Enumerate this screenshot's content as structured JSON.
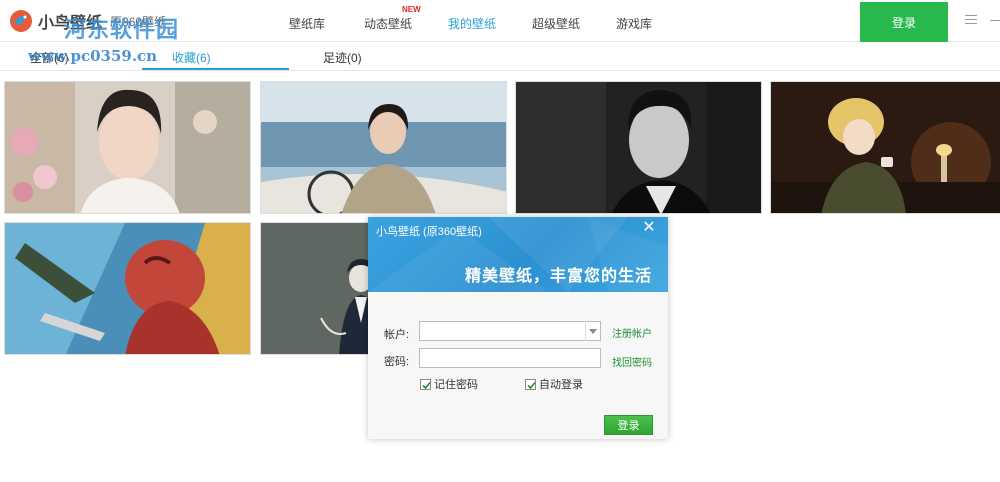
{
  "app": {
    "name": "小鸟壁纸",
    "subtitle": "原360壁纸",
    "watermark": "河东软件园",
    "watermark_url": "www.pc0359.cn"
  },
  "nav": {
    "items": [
      {
        "label": "壁纸库"
      },
      {
        "label": "动态壁纸",
        "badge": "NEW"
      },
      {
        "label": "我的壁纸",
        "active": true
      },
      {
        "label": "超级壁纸"
      },
      {
        "label": "游戏库"
      }
    ],
    "login_label": "登录"
  },
  "subtabs": {
    "items": [
      {
        "label": "全部(6)"
      },
      {
        "label": "收藏(6)",
        "active": true
      },
      {
        "label": "足迹(0)"
      }
    ]
  },
  "gallery": {
    "thumbnails": [
      {
        "subject": "portrait-man-flowers"
      },
      {
        "subject": "woman-on-boat"
      },
      {
        "subject": "portrait-man-bw"
      },
      {
        "subject": "anime-girl-lamp"
      },
      {
        "subject": "anime-titan"
      },
      {
        "subject": "anime-man-grey"
      }
    ]
  },
  "login_dialog": {
    "title": "小鸟壁纸 (原360壁纸)",
    "slogan": "精美壁纸，丰富您的生活",
    "account_label": "帐户:",
    "account_value": "",
    "password_label": "密码:",
    "password_value": "",
    "register_link": "注册帐户",
    "recover_link": "找回密码",
    "remember_label": "记住密码",
    "remember_checked": true,
    "autologin_label": "自动登录",
    "autologin_checked": true,
    "submit_label": "登录"
  },
  "colors": {
    "accent_blue": "#2a9fd6",
    "login_green": "#28b84c",
    "link_green": "#1f8e32"
  }
}
